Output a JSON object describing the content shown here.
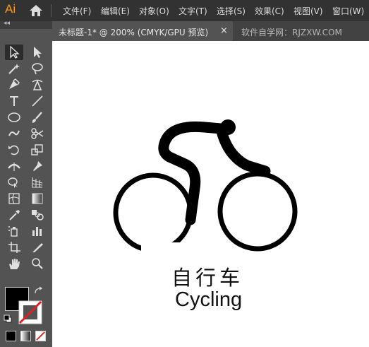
{
  "app": {
    "logo": "Ai",
    "brand_color": "#ff9a00"
  },
  "menubar": {
    "home_icon": "home-icon",
    "items": [
      "文件(F)",
      "编辑(E)",
      "对象(O)",
      "文字(T)",
      "选择(S)",
      "效果(C)",
      "视图(V)",
      "窗口(W)"
    ]
  },
  "tab": {
    "title": "未标题-1* @ 200% (CMYK/GPU 预览)",
    "close": "×"
  },
  "watermark": "软件自学网：RJZXW.COM",
  "toolbox": {
    "grip": "◂◂",
    "tools": [
      "selection-tool-icon",
      "direct-selection-tool-icon",
      "magic-wand-tool-icon",
      "lasso-tool-icon",
      "pen-tool-icon",
      "curvature-tool-icon",
      "type-tool-icon",
      "line-segment-tool-icon",
      "ellipse-tool-icon",
      "paintbrush-tool-icon",
      "shaper-tool-icon",
      "scissors-tool-icon",
      "rotate-tool-icon",
      "scale-tool-icon",
      "width-tool-icon",
      "puppet-warp-tool-icon",
      "shape-builder-tool-icon",
      "perspective-grid-tool-icon",
      "mesh-tool-icon",
      "gradient-tool-icon",
      "eyedropper-tool-icon",
      "blend-tool-icon",
      "symbol-sprayer-tool-icon",
      "column-graph-tool-icon",
      "artboard-tool-icon",
      "slice-tool-icon",
      "hand-tool-icon",
      "zoom-tool-icon"
    ],
    "selected_tool": "selection-tool-icon",
    "fill_color": "#000000",
    "stroke": "none"
  },
  "artwork": {
    "chinese_label": "自行车",
    "english_label": "Cycling",
    "ink_color": "#000000"
  }
}
